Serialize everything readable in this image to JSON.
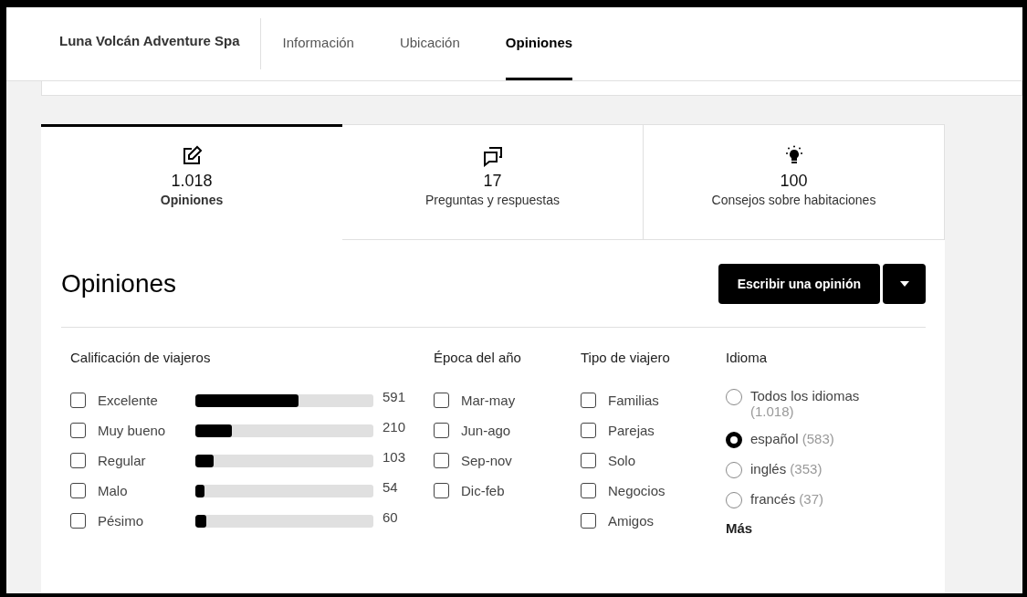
{
  "nav": {
    "brand": "Luna Volcán Adventure Spa",
    "tabs": [
      {
        "label": "Información",
        "selected": false
      },
      {
        "label": "Ubicación",
        "selected": false
      },
      {
        "label": "Opiniones",
        "selected": true
      }
    ]
  },
  "summary_tabs": [
    {
      "kind": "reviews",
      "count": "1.018",
      "label": "Opiniones",
      "selected": true
    },
    {
      "kind": "questions",
      "count": "17",
      "label": "Preguntas y respuestas",
      "selected": false
    },
    {
      "kind": "tips",
      "count": "100",
      "label": "Consejos sobre habitaciones",
      "selected": false
    }
  ],
  "heading": "Opiniones",
  "write_button": "Escribir una opinión",
  "filters": {
    "rating": {
      "title": "Calificación de viajeros",
      "items": [
        {
          "label": "Excelente",
          "checked": false,
          "level": 0.58,
          "count": "591"
        },
        {
          "label": "Muy bueno",
          "checked": false,
          "level": 0.206,
          "count": "210"
        },
        {
          "label": "Regular",
          "checked": false,
          "level": 0.1,
          "count": "103"
        },
        {
          "label": "Malo",
          "checked": false,
          "level": 0.053,
          "count": "54"
        },
        {
          "label": "Pésimo",
          "checked": false,
          "level": 0.059,
          "count": "60"
        }
      ]
    },
    "season": {
      "title": "Época del año",
      "items": [
        {
          "label": "Mar-may",
          "checked": false
        },
        {
          "label": "Jun-ago",
          "checked": false
        },
        {
          "label": "Sep-nov",
          "checked": false
        },
        {
          "label": "Dic-feb",
          "checked": false
        }
      ]
    },
    "traveler": {
      "title": "Tipo de viajero",
      "items": [
        {
          "label": "Familias",
          "checked": false
        },
        {
          "label": "Parejas",
          "checked": false
        },
        {
          "label": "Solo",
          "checked": false
        },
        {
          "label": "Negocios",
          "checked": false
        },
        {
          "label": "Amigos",
          "checked": false
        }
      ]
    },
    "language": {
      "title": "Idioma",
      "items": [
        {
          "label": "Todos los idiomas",
          "count": "(1.018)",
          "selected": false
        },
        {
          "label": "español",
          "count": "(583)",
          "selected": true
        },
        {
          "label": "inglés",
          "count": "(353)",
          "selected": false
        },
        {
          "label": "francés",
          "count": "(37)",
          "selected": false
        }
      ],
      "more": "Más"
    }
  }
}
